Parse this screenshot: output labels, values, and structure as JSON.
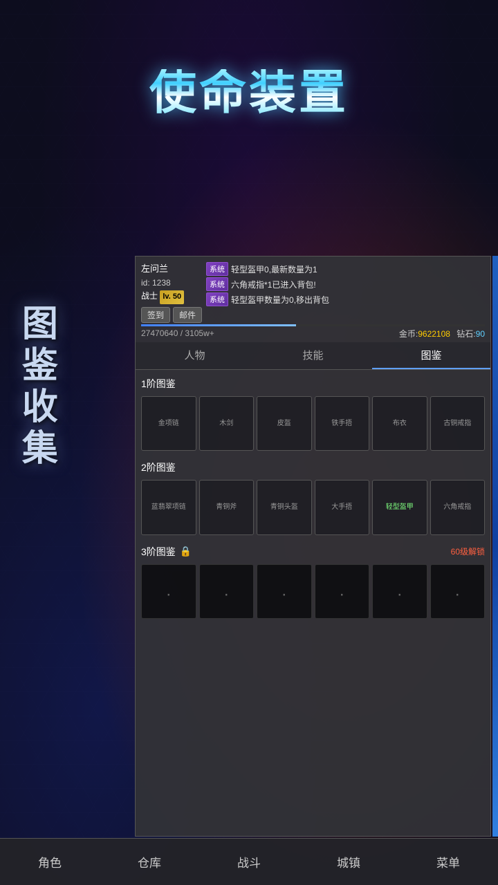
{
  "game": {
    "title": "使命装置"
  },
  "side_deco": {
    "text": "图鉴收集"
  },
  "player": {
    "name": "左问兰",
    "id_label": "id: 1238",
    "class_label": "战士",
    "lv_label": "lv. 50",
    "btn1": "签到",
    "btn2": "邮件"
  },
  "sys_messages": [
    {
      "tag": "系统",
      "text": "轻型盔甲0,最新数量为1"
    },
    {
      "tag": "系统",
      "text": "六角戒指*1已进入背包!"
    },
    {
      "tag": "系统",
      "text": "轻型盔甲数量为0,移出背包"
    }
  ],
  "progress": {
    "current": "27470640",
    "max": "3105w+",
    "display": "27470640 / 3105w+"
  },
  "currency": {
    "gold_label": "金币:",
    "gold_value": "9622108",
    "gem_label": "钻石:",
    "gem_value": "90"
  },
  "tabs": [
    {
      "label": "人物",
      "id": "character"
    },
    {
      "label": "技能",
      "id": "skills"
    },
    {
      "label": "图鉴",
      "id": "collection",
      "active": true
    }
  ],
  "sections": {
    "tier1": {
      "header": "1阶图鉴",
      "items": [
        {
          "label": "金项链",
          "state": "empty"
        },
        {
          "label": "木剑",
          "state": "empty"
        },
        {
          "label": "皮盔",
          "state": "empty"
        },
        {
          "label": "铁手捂",
          "state": "empty"
        },
        {
          "label": "布衣",
          "state": "empty"
        },
        {
          "label": "古铜戒指",
          "state": "empty"
        }
      ]
    },
    "tier2": {
      "header": "2阶图鉴",
      "items": [
        {
          "label": "蓝翡翠项链",
          "state": "empty"
        },
        {
          "label": "青铜斧",
          "state": "empty"
        },
        {
          "label": "青铜头盔",
          "state": "empty"
        },
        {
          "label": "大手捂",
          "state": "empty"
        },
        {
          "label": "轻型盔甲",
          "state": "highlight"
        },
        {
          "label": "六角戒指",
          "state": "empty"
        }
      ]
    },
    "tier3": {
      "header": "3阶图鉴",
      "lock_icon": "🔒",
      "unlock_text": "60级解锁",
      "items": [
        {
          "label": "",
          "state": "dark"
        },
        {
          "label": "",
          "state": "dark"
        },
        {
          "label": "",
          "state": "dark"
        },
        {
          "label": "",
          "state": "dark"
        },
        {
          "label": "",
          "state": "dark"
        },
        {
          "label": "",
          "state": "dark"
        }
      ]
    }
  },
  "bottom_nav": [
    {
      "label": "角色",
      "id": "role"
    },
    {
      "label": "仓库",
      "id": "warehouse"
    },
    {
      "label": "战斗",
      "id": "battle"
    },
    {
      "label": "城镇",
      "id": "town"
    },
    {
      "label": "菜单",
      "id": "menu"
    }
  ]
}
